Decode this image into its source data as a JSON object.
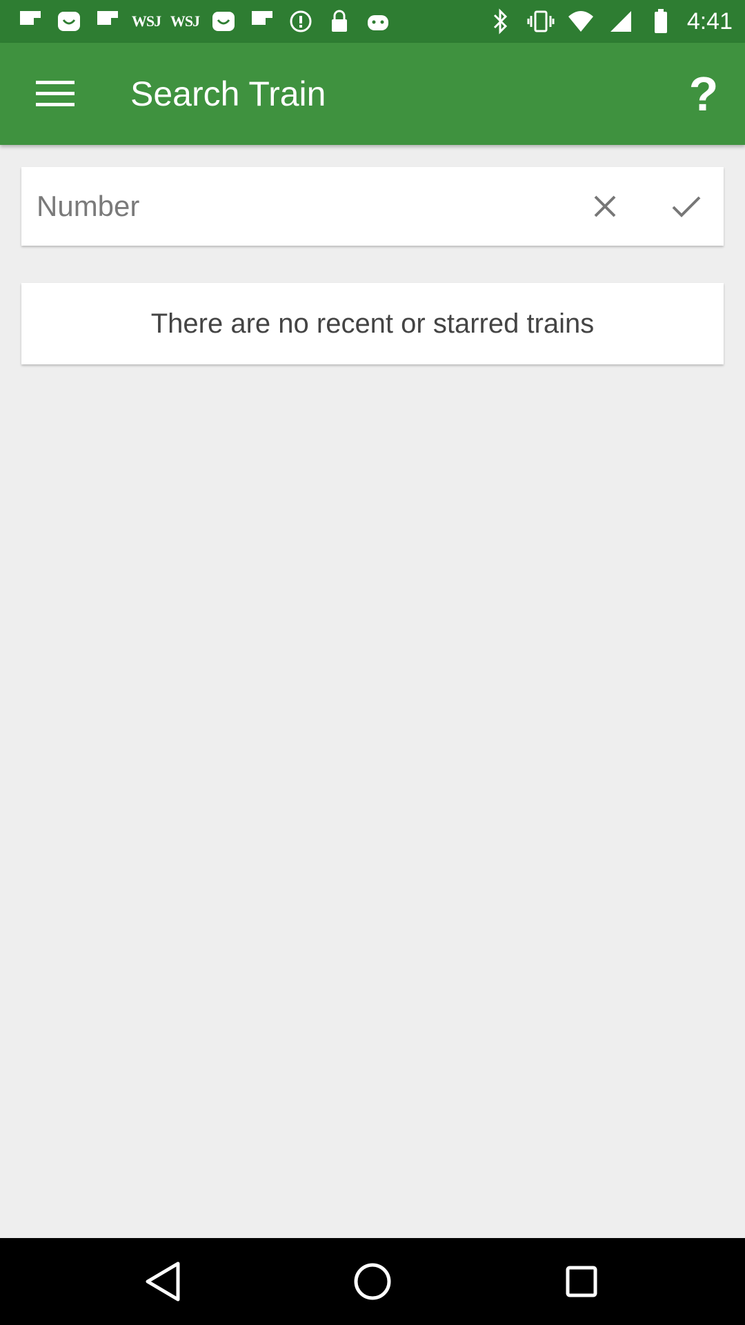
{
  "status_bar": {
    "time": "4:41",
    "left_icons": [
      "flipboard-icon",
      "smiley-icon",
      "flipboard-icon",
      "wsj-icon",
      "wsj-icon",
      "smiley-icon",
      "flipboard-icon",
      "info-icon",
      "lock-icon",
      "android-icon"
    ],
    "wsj_label": "WSJ",
    "right_icons": [
      "bluetooth-icon",
      "vibrate-icon",
      "wifi-icon",
      "signal-icon",
      "battery-icon"
    ]
  },
  "app_bar": {
    "title": "Search Train",
    "menu_icon": "hamburger-menu-icon",
    "help_label": "?",
    "background_color": "#3f923f",
    "status_bar_color": "#2e7d32"
  },
  "search": {
    "placeholder": "Number",
    "value": "",
    "clear_icon": "close-icon",
    "confirm_icon": "check-icon"
  },
  "empty_state": {
    "message": "There are no recent or starred trains"
  },
  "nav_bar": {
    "buttons": [
      "back-icon",
      "home-icon",
      "recents-icon"
    ]
  }
}
